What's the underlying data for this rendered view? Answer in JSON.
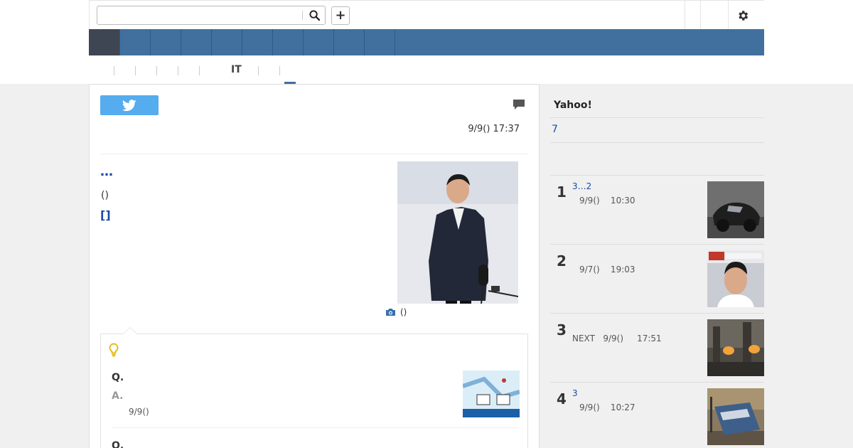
{
  "search": {
    "value": "",
    "placeholder": ""
  },
  "header": {
    "plus_label": "+"
  },
  "subnav": {
    "it_label": "IT"
  },
  "article": {
    "date": "9/9() 17:37",
    "headline": "…",
    "source": "()",
    "link": "[]",
    "photo_caption": "()"
  },
  "qa": {
    "q1": "Q.",
    "a1": "A.",
    "date1": "9/9()",
    "q2": "Q."
  },
  "sidebar": {
    "title": "Yahoo!",
    "link": "7",
    "ranking": [
      {
        "rank": "1",
        "title": "3…2",
        "meta": "9/9()    10:30"
      },
      {
        "rank": "2",
        "title": "",
        "meta": "9/7()    19:03"
      },
      {
        "rank": "3",
        "title": "",
        "meta": "NEXT   9/9()     17:51"
      },
      {
        "rank": "4",
        "title": "3",
        "meta": "9/9()    10:27"
      }
    ]
  },
  "colors": {
    "nav_blue": "#41709e",
    "nav_dark": "#3e4653",
    "link_blue": "#1a4aa8",
    "twitter_blue": "#55acee"
  },
  "icons": [
    "search-icon",
    "plus-icon",
    "gear-icon",
    "twitter-icon",
    "comment-icon",
    "camera-icon",
    "lightbulb-icon"
  ]
}
